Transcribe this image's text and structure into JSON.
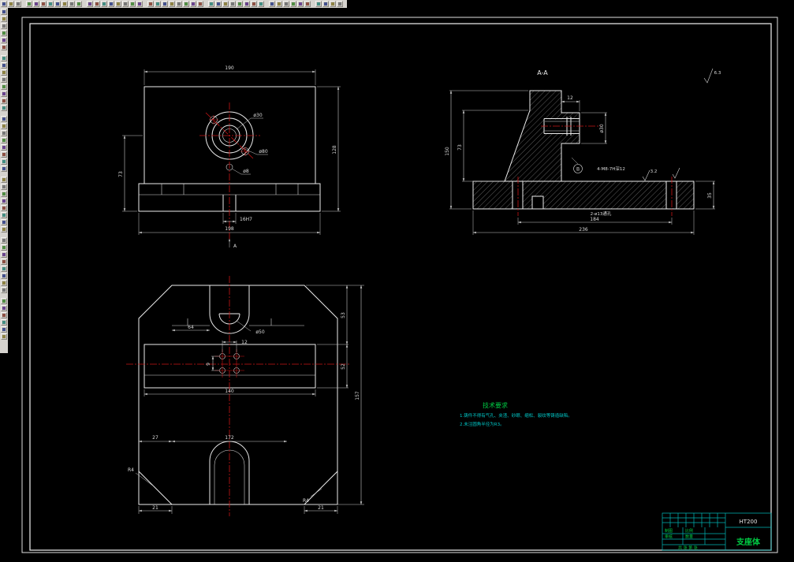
{
  "app": {
    "canvas_bg": "#000000",
    "toolbar_bg": "#d6d3ce",
    "line_color": "#ebebeb",
    "dim_color": "#c8c8c8",
    "centerline_color": "#c81414",
    "green": "#00cc44",
    "cyan": "#00c8c8"
  },
  "front_view": {
    "dim_top": "190",
    "dim_right": "128",
    "dim_left": "73",
    "label_bore": "ø30",
    "label_flange": "ø80",
    "label_hole": "ø8",
    "dim_slot": "16H7",
    "dim_bottom": "198",
    "section_letter": "A"
  },
  "section_view": {
    "title": "A-A",
    "dim_left_total": "150",
    "dim_left_wall": "73",
    "dim_boss_w": "12",
    "label_bore": "ø30",
    "note_tapped": "4-M8-7H深12",
    "datum": "B",
    "note_base_holes": "2-ø13通孔",
    "dim_holes": "184",
    "dim_total": "236",
    "dim_right": "35",
    "rough_sheet": "6.3",
    "rough_base": "3.2"
  },
  "top_view": {
    "dim_notch": "64",
    "label_boss": "ø50",
    "dim_hole_span": "12",
    "dim_hole_v": "9",
    "dim_band": "140",
    "dim_right_upper": "53",
    "dim_right_lower": "52",
    "dim_right_total": "157",
    "dim_bottom_left": "27",
    "dim_bottom_mid": "172",
    "dim_chamfer_left": "21",
    "dim_chamfer_right": "21",
    "radius_left": "R4",
    "radius_right": "R4"
  },
  "tech_requirements": {
    "title": "技术要求",
    "line1": "1.铸件不得有气孔、夹渣、砂眼、缩松、裂纹等铸造缺陷。",
    "line2": "2.未注圆角半径为R3。"
  },
  "title_block": {
    "material": "HT200",
    "part_name": "支座体",
    "cell_draw": "制图",
    "cell_check": "审核",
    "cell_scale": "比例",
    "cell_qty": "数量",
    "sheet_note": "共 张 第 张"
  }
}
